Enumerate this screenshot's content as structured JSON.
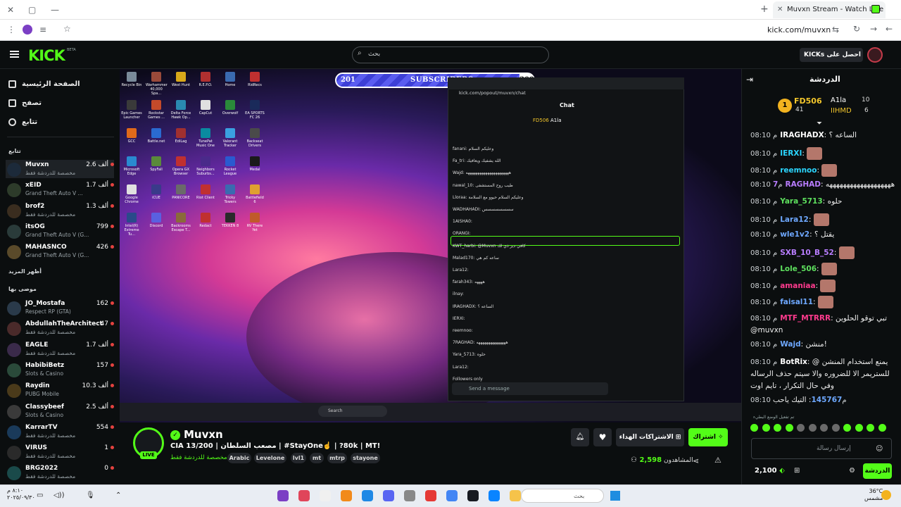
{
  "browser": {
    "tab_title": "Muvxn Stream - Watch Live on",
    "url": "kick.com/muvxn"
  },
  "header": {
    "logo": "KICK",
    "logo_beta": "BETA",
    "search_placeholder": "بحث",
    "get_kicks": "احصل على KICKs"
  },
  "sidebar": {
    "nav": [
      "الصفحة الرئيسية",
      "تصفح",
      "تتابع"
    ],
    "following_head": "تتابع",
    "show_more": "أظهر المزيد",
    "recommended_head": "موصى بها",
    "following": [
      {
        "name": "Muvxn",
        "sub": "مخصصة للدردشة فقط",
        "viewers": "2.6 ألف"
      },
      {
        "name": "xEID",
        "sub": "Grand Theft Auto V ...",
        "viewers": "1.7 ألف"
      },
      {
        "name": "brof2",
        "sub": "مخصصة للدردشة فقط",
        "viewers": "1.3 ألف"
      },
      {
        "name": "itsOG",
        "sub": "Grand Theft Auto V (G...",
        "viewers": "799"
      },
      {
        "name": "MAHASNCO",
        "sub": "Grand Theft Auto V (G...",
        "viewers": "426"
      }
    ],
    "recommended": [
      {
        "name": "JO_Mostafa",
        "sub": "Respect RP (GTA)",
        "viewers": "162"
      },
      {
        "name": "AbdullahTheArchitect",
        "sub": "مخصصة للدردشة فقط",
        "viewers": "47"
      },
      {
        "name": "EAGLE",
        "sub": "مخصصة للدردشة فقط",
        "viewers": "1.7 ألف"
      },
      {
        "name": "HabibiBetz",
        "sub": "Slots & Casino",
        "viewers": "157"
      },
      {
        "name": "Raydin",
        "sub": "PUBG Mobile",
        "viewers": "10.3 ألف"
      },
      {
        "name": "Classybeef",
        "sub": "Slots & Casino",
        "viewers": "2.5 ألف"
      },
      {
        "name": "KarrarTV",
        "sub": "مخصصة للدردشة فقط",
        "viewers": "554"
      },
      {
        "name": "VIRUS",
        "sub": "مخصصة للدردشة فقط",
        "viewers": "1"
      },
      {
        "name": "BRG2022",
        "sub": "مخصصة للدردشة فقط",
        "viewers": "0"
      }
    ]
  },
  "player": {
    "sub_goal": {
      "current": "201",
      "label": "SUBSCRIBERS",
      "target": "300",
      "progress": 0.67
    },
    "popout_url": "kick.com/popout/muvxn/chat",
    "popout_title": "Chat",
    "popout_send": "Send a message",
    "taskbar_search": "Search",
    "desktop_icons": [
      "Recycle Bin",
      "Warhammer 40,000 Spa...",
      "West Hunt",
      "R.E.P.O.",
      "Home",
      "RidRecs",
      "Epic Games Launcher",
      "Rockstar Games ...",
      "Delta Force Hawk Op...",
      "CapCut",
      "Overwolf",
      "EA SPORTS FC 26",
      "GCC",
      "Battle.net",
      "EdiLag",
      "TunePat Music One",
      "Valorant Tracker",
      "Backseat Drivers",
      "Microsoft Edge",
      "SpyFall",
      "Opera GX Browser",
      "Neighbors Suburbs...",
      "Rocket League",
      "Medal",
      "Google Chrome",
      "iCUE",
      "PANICORE",
      "Riot Client",
      "Tricky Towers",
      "Battlefield 6",
      "Intel(R) Extreme Tu...",
      "Discord",
      "Backrooms Escape T...",
      "Redact",
      "TEKKEN 8",
      "RV There Yet"
    ],
    "popout_lines": [
      "fanani: وعليكم السلام",
      "Fa_tri: الله يشفيك ويعافيك",
      "Wajd: ههههههههههههههههههههههه",
      "nawal_10: طيب روح المستشفى",
      "Lloraa: وعليكم السلام حيوو مع السلامة",
      "WADHAHADI: سسسسسسسس",
      "1AISHA0:",
      "ORANGI:",
      "KWT_harbi: @Muvxn كافي دير ذي لك",
      "Malad170: ساعه كم هي",
      "Lara12:",
      "farah343: ههههه",
      "ilnay:",
      "IRAGHADX: الساعه ؟",
      "IERXI:",
      "reemnoo:",
      "7RAGHAD: هههههههههههههههه",
      "Yara_5713: حلوه",
      "Lara12:",
      "Followers only"
    ]
  },
  "stream": {
    "name": "Muvxn",
    "live": "LIVE",
    "title": "CIA مصعب السلطان | 13/200 | #StayOne☝️ | ?80k | MT!",
    "category": "مخصصة للدردشة فقط",
    "tags": [
      "Arabic",
      "Levelone",
      "lvl1",
      "mt",
      "mtrp",
      "stayone"
    ],
    "subscribe": "اشتراك",
    "gift_subs": "الاشتراكات الهداء",
    "viewers_count": "2,598",
    "viewers_label": "المشاهدون"
  },
  "chat": {
    "title": "الدردشة",
    "top_gifter": {
      "name": "FD506",
      "count": "41",
      "second": "A1la",
      "second_count": "10",
      "third": "IIHMD",
      "third_count": "6"
    },
    "messages": [
      {
        "time": "08:10 م",
        "user": "IRAGHADX",
        "color": "#ffffff",
        "text": "الساعه ؟"
      },
      {
        "time": "08:10 م",
        "user": "IERXI",
        "color": "#2bd6ff",
        "text": ""
      },
      {
        "time": "08:10 م",
        "user": "reemnoo",
        "color": "#2bd6ff",
        "text": ""
      },
      {
        "time": "08:10 م",
        "user": "7RAGHAD",
        "color": "#b87dff",
        "text": "هههههههههههههههههههه"
      },
      {
        "time": "08:10 م",
        "user": "Yara_5713",
        "color": "#5ee05e",
        "text": "حلوه"
      },
      {
        "time": "08:10 م",
        "user": "Lara12",
        "color": "#6ea8ff",
        "text": ""
      },
      {
        "time": "08:10 م",
        "user": "wle1v2",
        "color": "#6ea8ff",
        "text": "يقتل ؟"
      },
      {
        "time": "08:10 م",
        "user": "SXB_10_B_52",
        "color": "#b87dff",
        "text": ""
      },
      {
        "time": "08:10 م",
        "user": "Lole_506",
        "color": "#5ee05e",
        "text": ""
      },
      {
        "time": "08:10 م",
        "user": "amaniaa",
        "color": "#ff3b8e",
        "text": ""
      },
      {
        "time": "08:10 م",
        "user": "faisal11",
        "color": "#6ea8ff",
        "text": ""
      },
      {
        "time": "08:10 م",
        "user": "MTF_MTRRR",
        "color": "#ff3b8e",
        "text": "تبي توقو الحلوين @muvxn"
      },
      {
        "time": "08:10 م",
        "user": "Wajd",
        "color": "#6ea8ff",
        "text": "منشن!"
      },
      {
        "time": "08:10 م",
        "user": "BotRix",
        "color": "#ffffff",
        "text": "يمنع استخدام المنشن @ للستريمر الا للضروره والا سيتم حذف الرساله وفي حال التكرار ، تايم اوت"
      },
      {
        "time": "08:10 م",
        "user": "145767",
        "color": "#6ea8ff",
        "text": "التيك ياحب"
      }
    ],
    "hype_note": "تم تفعيل الوضع البطيء",
    "input_placeholder": "إرسال رسالة",
    "send": "الدردشة",
    "points": "2,100"
  },
  "taskbar": {
    "clock_time": "٨:١٠ م",
    "clock_date": "٢٠٢٥/٠٩/٣٠",
    "search": "بحث",
    "weather_temp": "36°C",
    "weather_text": "مشمس"
  }
}
